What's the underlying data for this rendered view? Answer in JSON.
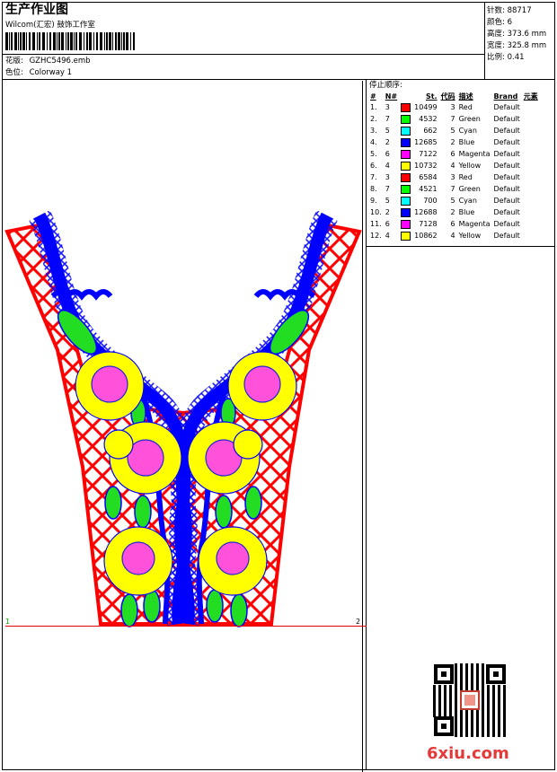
{
  "header": {
    "title": "生产作业图",
    "subtitle": "Wilcom(汇宏) 鼓饰工作室",
    "design_label": "花版:",
    "design_value": "GZHC5496.emb",
    "colorway_label": "色位:",
    "colorway_value": "Colorway 1"
  },
  "stats": [
    {
      "label": "针数:",
      "value": "88717"
    },
    {
      "label": "颜色:",
      "value": "6"
    },
    {
      "label": "高度:",
      "value": "373.6 mm"
    },
    {
      "label": "宽度:",
      "value": "325.8 mm"
    },
    {
      "label": "比例:",
      "value": "0.41"
    }
  ],
  "sequence": {
    "title": "停止顺序:",
    "headers": [
      "#",
      "N#",
      "",
      "St.",
      "代码",
      "描述",
      "Brand",
      "元素"
    ],
    "rows": [
      {
        "idx": "1.",
        "n": "3",
        "color": "#ff0000",
        "st": "10499",
        "code": "3",
        "desc": "Red",
        "brand": "Default"
      },
      {
        "idx": "2.",
        "n": "7",
        "color": "#00ff00",
        "st": "4532",
        "code": "7",
        "desc": "Green",
        "brand": "Default"
      },
      {
        "idx": "3.",
        "n": "5",
        "color": "#00ffff",
        "st": "662",
        "code": "5",
        "desc": "Cyan",
        "brand": "Default"
      },
      {
        "idx": "4.",
        "n": "2",
        "color": "#0000ff",
        "st": "12685",
        "code": "2",
        "desc": "Blue",
        "brand": "Default"
      },
      {
        "idx": "5.",
        "n": "6",
        "color": "#ff00ff",
        "st": "7122",
        "code": "6",
        "desc": "Magenta",
        "brand": "Default"
      },
      {
        "idx": "6.",
        "n": "4",
        "color": "#ffff00",
        "st": "10732",
        "code": "4",
        "desc": "Yellow",
        "brand": "Default"
      },
      {
        "idx": "7.",
        "n": "3",
        "color": "#ff0000",
        "st": "6584",
        "code": "3",
        "desc": "Red",
        "brand": "Default"
      },
      {
        "idx": "8.",
        "n": "7",
        "color": "#00ff00",
        "st": "4521",
        "code": "7",
        "desc": "Green",
        "brand": "Default"
      },
      {
        "idx": "9.",
        "n": "5",
        "color": "#00ffff",
        "st": "700",
        "code": "5",
        "desc": "Cyan",
        "brand": "Default"
      },
      {
        "idx": "10.",
        "n": "2",
        "color": "#0000ff",
        "st": "12688",
        "code": "2",
        "desc": "Blue",
        "brand": "Default"
      },
      {
        "idx": "11.",
        "n": "6",
        "color": "#ff00ff",
        "st": "7128",
        "code": "6",
        "desc": "Magenta",
        "brand": "Default"
      },
      {
        "idx": "12.",
        "n": "4",
        "color": "#ffff00",
        "st": "10862",
        "code": "4",
        "desc": "Yellow",
        "brand": "Default"
      }
    ]
  },
  "hoop_markers": {
    "left": "1",
    "right": "2"
  },
  "watermark": "6xiu.com",
  "colors": {
    "red": "#ff0000",
    "blue": "#0000ff",
    "green": "#00ff00",
    "yellow": "#ffff00",
    "magenta": "#ff00ff"
  }
}
